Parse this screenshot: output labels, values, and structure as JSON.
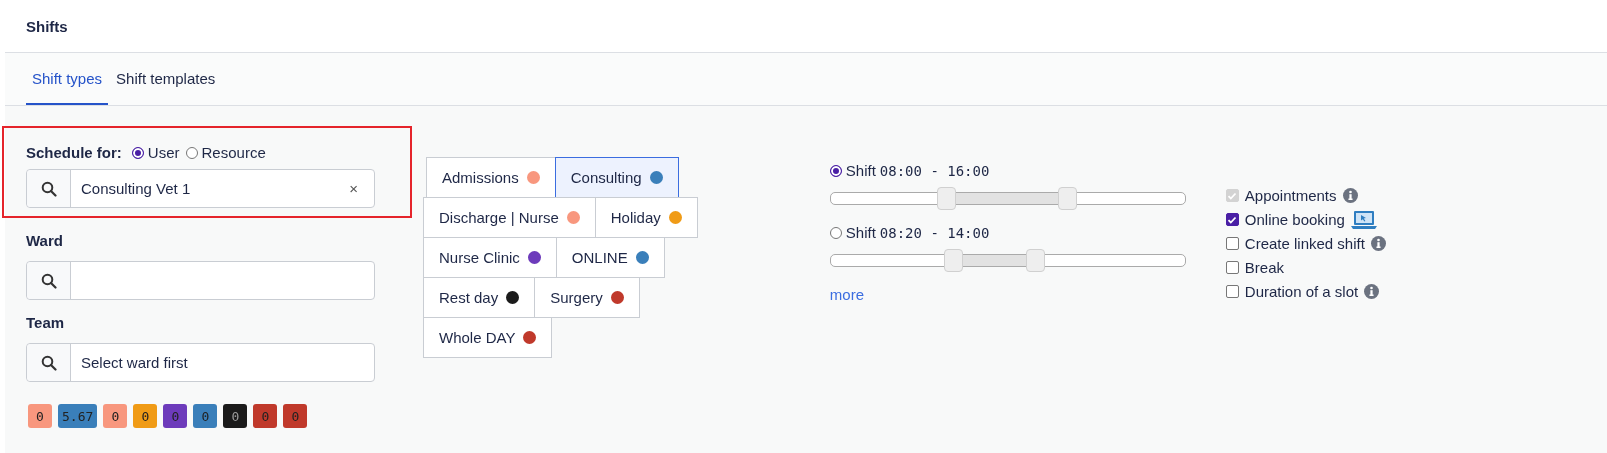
{
  "page_title": "Shifts",
  "tabs": [
    {
      "label": "Shift types",
      "selected": true
    },
    {
      "label": "Shift templates",
      "selected": false
    }
  ],
  "schedule_for": {
    "label": "Schedule for:",
    "options": [
      {
        "label": "User",
        "selected": true
      },
      {
        "label": "Resource",
        "selected": false
      }
    ],
    "field": {
      "value": "Consulting Vet 1",
      "clear": "×"
    }
  },
  "ward": {
    "label": "Ward"
  },
  "team": {
    "label": "Team",
    "field": {
      "placeholder": "Select ward first"
    }
  },
  "totals": [
    {
      "value": "0",
      "color": "#f8977e"
    },
    {
      "value": "5.67",
      "color": "#3a7fba"
    },
    {
      "value": "0",
      "color": "#f8977e"
    },
    {
      "value": "0",
      "color": "#f09b16"
    },
    {
      "value": "0",
      "color": "#6d3bbb"
    },
    {
      "value": "0",
      "color": "#3a7fba"
    },
    {
      "value": "0",
      "color": "#1b1b1b"
    },
    {
      "value": "0",
      "color": "#c0392b"
    },
    {
      "value": "0",
      "color": "#c0392b"
    }
  ],
  "shift_type_rows": [
    [
      {
        "label": "Admissions",
        "color": "#f8977e",
        "selected": false
      },
      {
        "label": "Consulting",
        "color": "#3a7fba",
        "selected": true
      }
    ],
    [
      {
        "label": "Discharge | Nurse",
        "color": "#f8977e",
        "selected": false
      },
      {
        "label": "Holiday",
        "color": "#f09b16",
        "selected": false
      }
    ],
    [
      {
        "label": "Nurse Clinic",
        "color": "#6d3bbb",
        "selected": false
      },
      {
        "label": "ONLINE",
        "color": "#3a7fba",
        "selected": false
      }
    ],
    [
      {
        "label": "Rest day",
        "color": "#1b1b1b",
        "selected": false
      },
      {
        "label": "Surgery",
        "color": "#c0392b",
        "selected": false
      }
    ],
    [
      {
        "label": "Whole DAY",
        "color": "#c0392b",
        "selected": false
      }
    ]
  ],
  "shifts": [
    {
      "label": "Shift",
      "time": "08:00 - 16:00",
      "selected": true,
      "start": {
        "level": 0.33
      },
      "end": {
        "level": 0.67
      }
    },
    {
      "label": "Shift",
      "time": "08:20 - 14:00",
      "selected": false,
      "start": {
        "level": 0.35
      },
      "end": {
        "level": 0.58
      }
    }
  ],
  "more_link": "more",
  "options": [
    {
      "label": "Appointments",
      "checked": true,
      "disabled": true,
      "kind": "info"
    },
    {
      "label": "Online booking",
      "checked": true,
      "disabled": false,
      "kind": "device"
    },
    {
      "label": "Create linked shift",
      "checked": false,
      "disabled": false,
      "kind": "info"
    },
    {
      "label": "Break",
      "checked": false,
      "disabled": false,
      "kind": "plain"
    },
    {
      "label": "Duration of a slot",
      "checked": false,
      "disabled": false,
      "kind": "info"
    }
  ]
}
